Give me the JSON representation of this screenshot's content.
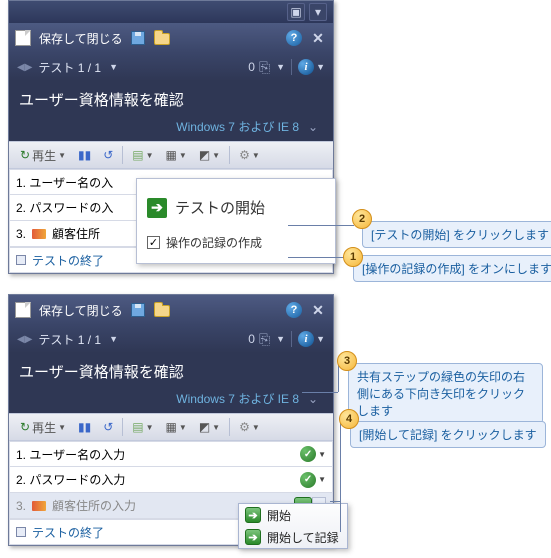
{
  "toolbar": {
    "save_close_label": "保存して閉じる"
  },
  "testnav": {
    "label": "テスト 1 / 1",
    "count": "0"
  },
  "test_title": "ユーザー資格情報を確認",
  "environment": "Windows 7 および IE 8",
  "replay": {
    "play_label": "再生"
  },
  "steps_top": [
    {
      "label": "1. ユーザー名の入"
    },
    {
      "label": "2. パスワードの入"
    },
    {
      "label": "3.",
      "shared_label": "顧客住所"
    },
    {
      "label": "テストの終了"
    }
  ],
  "steps_bottom": [
    {
      "label": "1. ユーザー名の入力"
    },
    {
      "label": "2. パスワードの入力"
    },
    {
      "label": "3.",
      "shared_label": "顧客住所の入力"
    },
    {
      "label": "テストの終了"
    }
  ],
  "popup": {
    "start_label": "テストの開始",
    "create_recording_label": "操作の記録の作成"
  },
  "menu": {
    "start": "開始",
    "start_record": "開始して記録"
  },
  "callouts": {
    "c1": "[操作の記録の作成] をオンにします",
    "c2": "[テストの開始] をクリックします",
    "c3": "共有ステップの緑色の矢印の右側にある下向き矢印をクリックします",
    "c4": "[開始して記録] をクリックします"
  },
  "badges": {
    "b1": "1",
    "b2": "2",
    "b3": "3",
    "b4": "4"
  }
}
